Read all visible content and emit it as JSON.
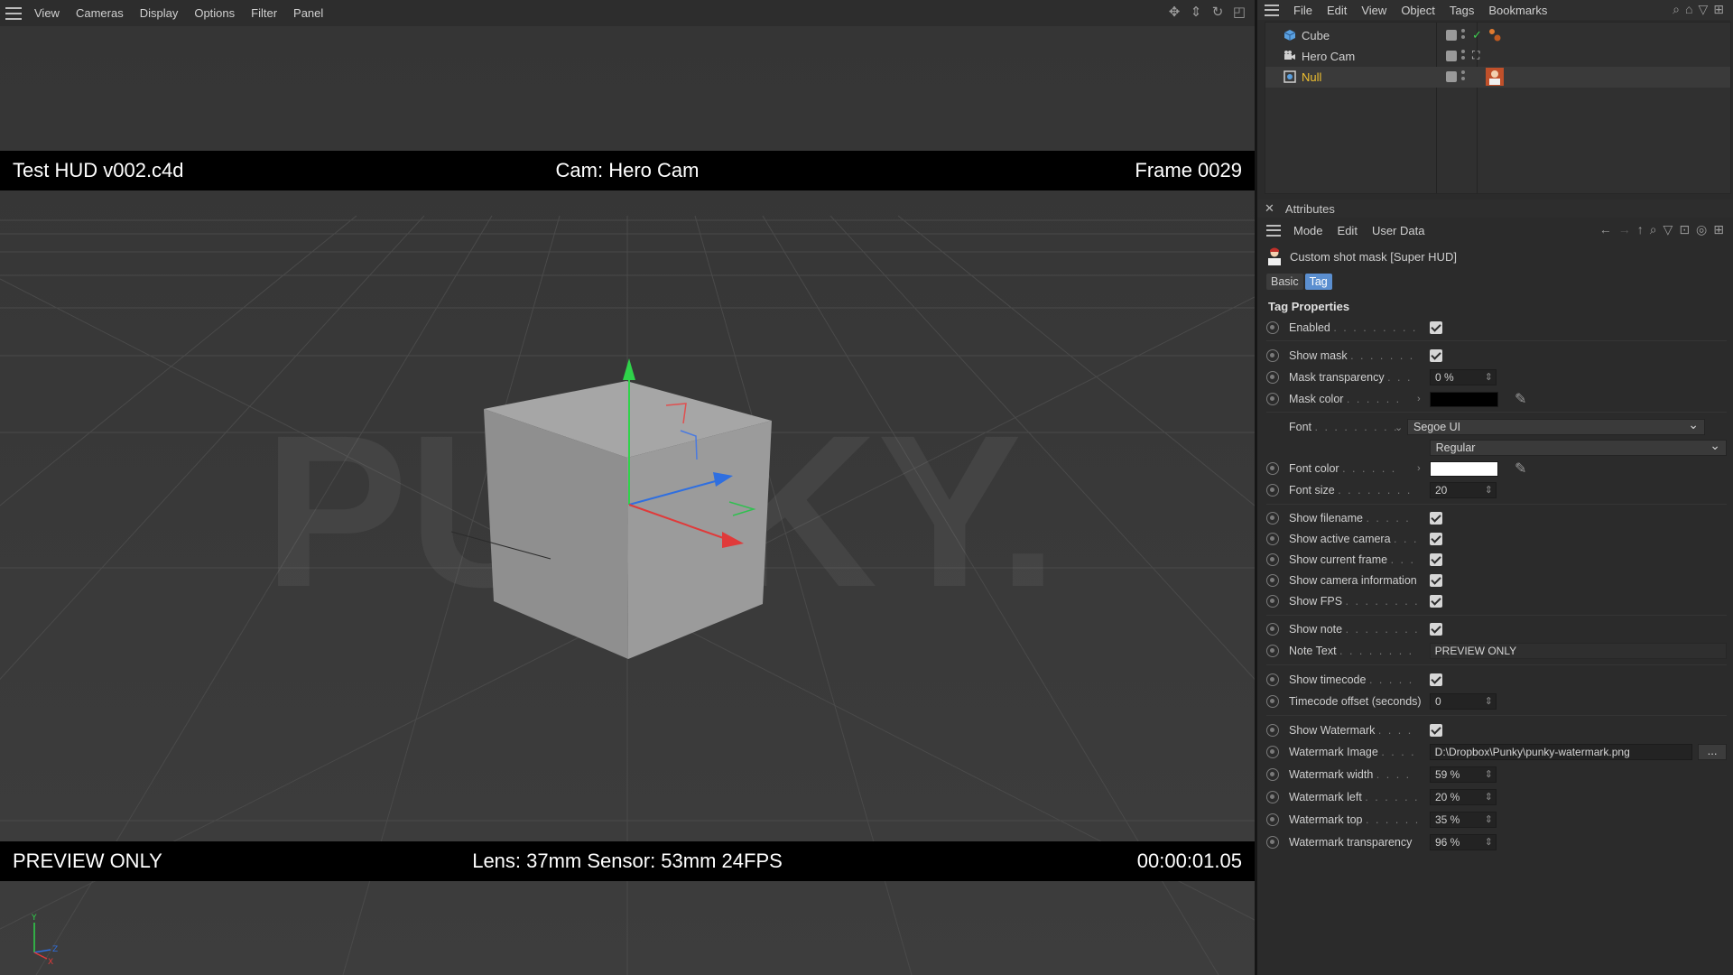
{
  "viewport": {
    "menu": [
      "View",
      "Cameras",
      "Display",
      "Options",
      "Filter",
      "Panel"
    ],
    "hud": {
      "filename": "Test HUD v002.c4d",
      "camera": "Cam: Hero Cam",
      "frame": "Frame 0029",
      "note": "PREVIEW ONLY",
      "camera_info": "Lens: 37mm Sensor: 53mm 24FPS",
      "timecode": "00:00:01.05"
    },
    "watermark_text": "PUNKY.",
    "tool_icons": [
      "move-icon",
      "pan-icon",
      "rotate-icon",
      "maximize-icon"
    ]
  },
  "object_manager": {
    "menu": [
      "File",
      "Edit",
      "View",
      "Object",
      "Tags",
      "Bookmarks"
    ],
    "objects": [
      {
        "name": "Cube",
        "icon": "cube-icon"
      },
      {
        "name": "Hero Cam",
        "icon": "camera-icon"
      },
      {
        "name": "Null",
        "icon": "null-icon",
        "selected": true
      }
    ]
  },
  "attributes": {
    "title": "Attributes",
    "menu": [
      "Mode",
      "Edit",
      "User Data"
    ],
    "object_label": "Custom shot mask [Super HUD]",
    "tabs": [
      "Basic",
      "Tag"
    ],
    "active_tab": "Tag",
    "section": "Tag Properties",
    "props": {
      "enabled": "Enabled",
      "show_mask": "Show mask",
      "mask_transparency": "Mask transparency",
      "mask_transparency_val": "0 %",
      "mask_color": "Mask color",
      "font": "Font",
      "font_family": "Segoe UI",
      "font_style": "Regular",
      "font_color": "Font color",
      "font_size": "Font size",
      "font_size_val": "20",
      "show_filename": "Show filename",
      "show_active_camera": "Show active camera",
      "show_current_frame": "Show current frame",
      "show_camera_info": "Show camera information",
      "show_fps": "Show FPS",
      "show_note": "Show note",
      "note_text": "Note Text",
      "note_text_val": "PREVIEW ONLY",
      "show_timecode": "Show timecode",
      "timecode_offset": "Timecode offset (seconds)",
      "timecode_offset_val": "0",
      "show_watermark": "Show Watermark",
      "watermark_image": "Watermark Image",
      "watermark_image_val": "D:\\Dropbox\\Punky\\punky-watermark.png",
      "browse": "...",
      "watermark_width": "Watermark width",
      "watermark_width_val": "59 %",
      "watermark_left": "Watermark left",
      "watermark_left_val": "20 %",
      "watermark_top": "Watermark top",
      "watermark_top_val": "35 %",
      "watermark_transparency": "Watermark transparency",
      "watermark_transparency_val": "96 %"
    },
    "colors": {
      "mask_color": "#000000",
      "font_color": "#ffffff",
      "accent": "#5b8fd0"
    }
  }
}
